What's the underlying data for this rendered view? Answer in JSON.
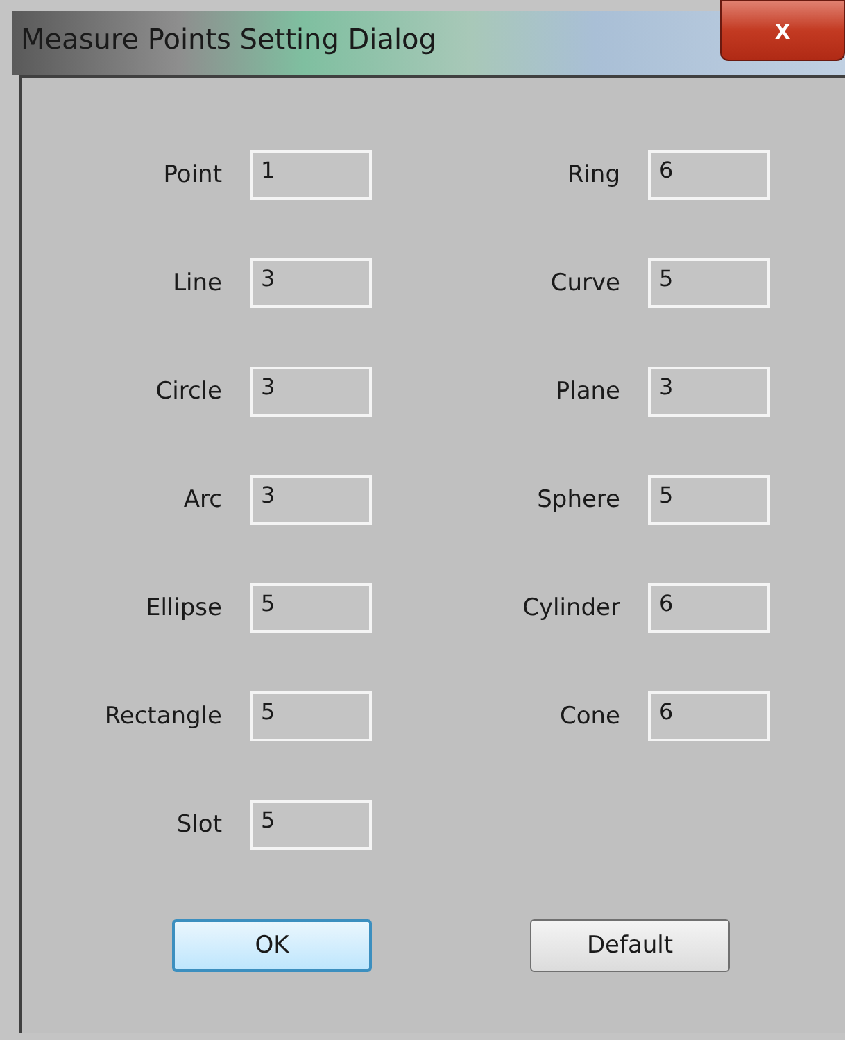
{
  "window": {
    "title": "Measure Points Setting Dialog",
    "close_label": "x"
  },
  "left_column": [
    {
      "label": "Point",
      "value": "1"
    },
    {
      "label": "Line",
      "value": "3"
    },
    {
      "label": "Circle",
      "value": "3"
    },
    {
      "label": "Arc",
      "value": "3"
    },
    {
      "label": "Ellipse",
      "value": "5"
    },
    {
      "label": "Rectangle",
      "value": "5"
    },
    {
      "label": "Slot",
      "value": "5"
    }
  ],
  "right_column": [
    {
      "label": "Ring",
      "value": "6"
    },
    {
      "label": "Curve",
      "value": "5"
    },
    {
      "label": "Plane",
      "value": "3"
    },
    {
      "label": "Sphere",
      "value": "5"
    },
    {
      "label": "Cylinder",
      "value": "6"
    },
    {
      "label": "Cone",
      "value": "6"
    }
  ],
  "buttons": [
    {
      "label": "OK",
      "kind": "default"
    },
    {
      "label": "Default",
      "kind": "normal"
    }
  ]
}
